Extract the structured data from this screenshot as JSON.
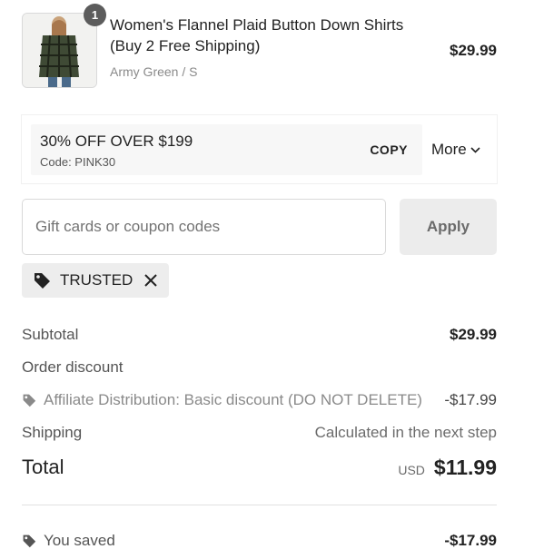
{
  "product": {
    "quantity": "1",
    "title": "Women's Flannel Plaid Button Down Shirts (Buy 2 Free Shipping)",
    "variant": "Army Green / S",
    "price": "$29.99"
  },
  "promo": {
    "title": "30% OFF OVER $199",
    "code_label": "Code: PINK30",
    "copy_label": "COPY",
    "more_label": "More"
  },
  "coupon": {
    "placeholder": "Gift cards or coupon codes",
    "apply_label": "Apply",
    "applied_tag": "TRUSTED"
  },
  "summary": {
    "subtotal_label": "Subtotal",
    "subtotal_value": "$29.99",
    "order_discount_label": "Order discount",
    "affiliate_label": "Affiliate Distribution: Basic discount (DO NOT DELETE)",
    "affiliate_value": "-$17.99",
    "shipping_label": "Shipping",
    "shipping_value": "Calculated in the next step",
    "total_label": "Total",
    "currency": "USD",
    "total_value": "$11.99",
    "saved_label": "You saved",
    "saved_value": "-$17.99"
  },
  "icons": {
    "tag": "tag-icon",
    "close": "close-icon",
    "chevron": "chevron-down-icon"
  }
}
